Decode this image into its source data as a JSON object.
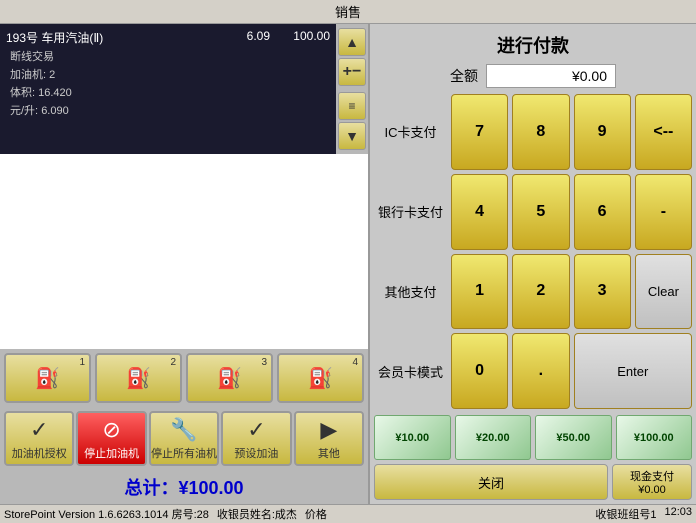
{
  "title": "销售",
  "left": {
    "sale_item": {
      "name": "193号 车用汽油(Ⅱ)",
      "price": "6.09",
      "total": "100.00",
      "type": "断线交易",
      "machine": "加油机:",
      "machine_num": "2",
      "volume_label": "体积:",
      "volume_val": "16.420",
      "price_label": "元/升:",
      "price_val": "6.090"
    },
    "pumps": [
      {
        "id": "1",
        "icon": "⛽"
      },
      {
        "id": "2",
        "icon": "⛽"
      },
      {
        "id": "3",
        "icon": "⛽"
      },
      {
        "id": "4",
        "icon": "⛽"
      }
    ],
    "actions": [
      {
        "label": "加油机授权",
        "icon": "✓",
        "style": "normal"
      },
      {
        "label": "停止加油机",
        "icon": "⊘",
        "style": "red"
      },
      {
        "label": "停止所有油机",
        "icon": "🔧",
        "style": "normal"
      },
      {
        "label": "预设加油",
        "icon": "✓",
        "style": "normal"
      },
      {
        "label": "其他",
        "icon": "▶",
        "style": "normal"
      }
    ],
    "total_label": "总计：¥100.00"
  },
  "right": {
    "title": "进行付款",
    "amount_label": "全额",
    "amount_value": "¥0.00",
    "payment_methods": [
      {
        "label": "IC卡支付",
        "row": 0
      },
      {
        "label": "银行卡支付",
        "row": 1
      },
      {
        "label": "其他支付",
        "row": 2
      },
      {
        "label": "会员卡模式",
        "row": 3
      }
    ],
    "numpad": {
      "row1": [
        "7",
        "8",
        "9",
        "<--"
      ],
      "row2": [
        "4",
        "5",
        "6",
        "-"
      ],
      "row3": [
        "1",
        "2",
        "3",
        "Clear"
      ],
      "row4": [
        "0",
        ".",
        "Enter"
      ]
    },
    "money_notes": [
      {
        "label": "¥10.00",
        "value": "10"
      },
      {
        "label": "¥20.00",
        "value": "20"
      },
      {
        "label": "¥50.00",
        "value": "50"
      },
      {
        "label": "¥100.00",
        "value": "100"
      }
    ],
    "close_label": "关闭",
    "cash_label": "现金支付",
    "cash_amount": "¥0.00"
  },
  "status": {
    "left": "StorePoint Version 1.6.6263.1014 房号:28",
    "mid": "收银员姓名:成杰",
    "price": "价格",
    "right": "收银班组号1",
    "time": "12:03"
  }
}
